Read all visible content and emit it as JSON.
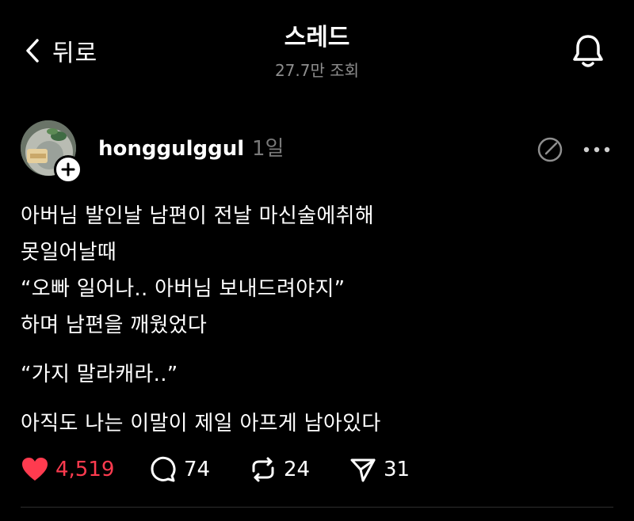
{
  "header": {
    "back_label": "뒤로",
    "title": "스레드",
    "views": "27.7만 조회"
  },
  "post": {
    "username": "honggulggul",
    "time": "1일",
    "lines": [
      "아버님 발인날 남편이 전날 마신술에취해",
      "못일어날때",
      "“오빠 일어나.. 아버님 보내드려야지”",
      "하며 남편을 깨웠었다",
      "“가지 말라캐라..”",
      "아직도 나는 이말이 제일 아프게 남아있다"
    ],
    "likes": "4,519",
    "comments": "74",
    "reposts": "24",
    "shares": "31"
  },
  "icons": {
    "back": "chevron-left-icon",
    "bell": "bell-icon",
    "follow": "plus-icon",
    "edit": "edit-icon",
    "more": "more-horizontal-icon",
    "like": "heart-icon",
    "comment": "comment-bubble-icon",
    "repost": "repost-icon",
    "share": "send-icon"
  },
  "colors": {
    "background": "#000000",
    "text": "#ffffff",
    "muted": "#8e8e8e",
    "like": "#ff3b4f"
  }
}
